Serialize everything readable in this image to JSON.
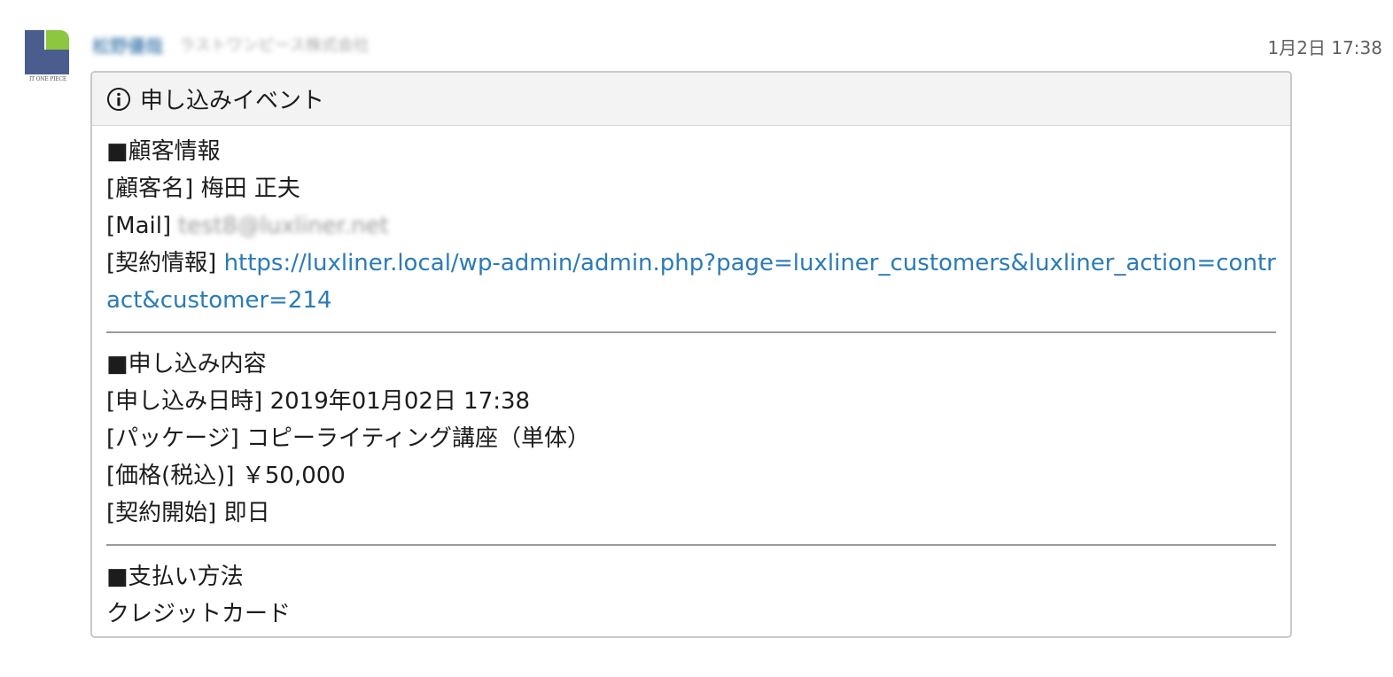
{
  "avatar": {
    "caption": "IT ONE PIECE",
    "colors": {
      "green": "#8dc63f",
      "navy": "#4b5d8f"
    }
  },
  "sender": {
    "name": "松野優哉",
    "company": "ラストワンピース株式会社"
  },
  "timestamp": "1月2日 17:38",
  "card": {
    "icon": "info-icon",
    "title": "申し込みイベント",
    "customer_section": {
      "heading": "■顧客情報",
      "name_label": "[顧客名]",
      "name_value": "梅田 正夫",
      "mail_label": "[Mail]",
      "mail_value": "test8@luxliner.net",
      "contract_label": "[契約情報]",
      "contract_link": "https://luxliner.local/wp-admin/admin.php?page=luxliner_customers&luxliner_action=contract&customer=214"
    },
    "application_section": {
      "heading": "■申し込み内容",
      "date_label": "[申し込み日時]",
      "date_value": "2019年01月02日 17:38",
      "package_label": "[パッケージ]",
      "package_value": "コピーライティング講座（単体）",
      "price_label": "[価格(税込)]",
      "price_value": "￥50,000",
      "start_label": "[契約開始]",
      "start_value": "即日"
    },
    "payment_section": {
      "heading": "■支払い方法",
      "method": "クレジットカード"
    }
  },
  "colors": {
    "link": "#2a7bb7",
    "header_bg": "#f3f3f3",
    "border": "#c9c9c9"
  }
}
